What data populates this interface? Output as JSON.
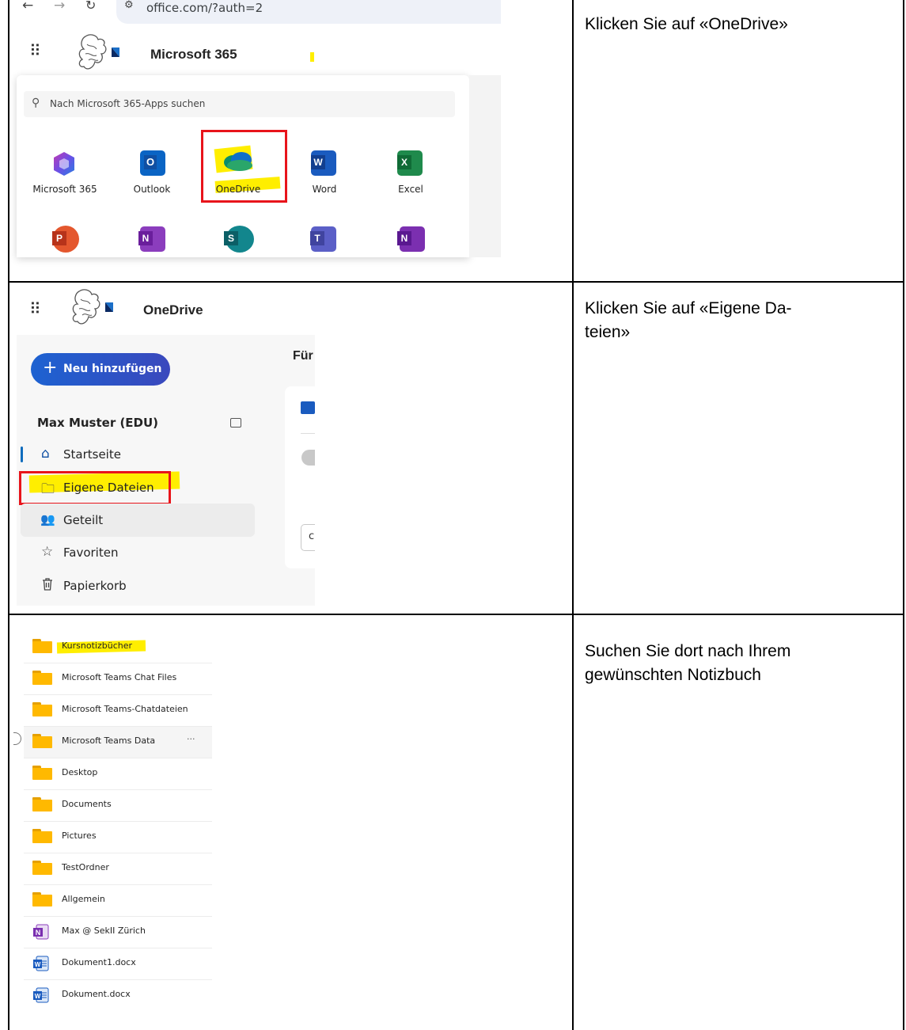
{
  "instructions": [
    "Klicken Sie auf «OneDrive»",
    "Klicken Sie auf «Eigene Da-\nteien»",
    "Suchen Sie dort nach Ihrem gewünschten Notizbuch"
  ],
  "step1": {
    "url": "office.com/?auth=2",
    "app_title": "Microsoft 365",
    "search_placeholder": "Nach Microsoft 365-Apps suchen",
    "apps_row1": [
      "Microsoft 365",
      "Outlook",
      "OneDrive",
      "Word",
      "Excel"
    ],
    "icon_letters": {
      "outlook": "O",
      "word": "W",
      "excel": "X",
      "powerpoint": "P",
      "onenote": "N",
      "sharepoint": "S",
      "teams": "T",
      "class_notebook": "N"
    },
    "colors": {
      "highlight": "#ffee00",
      "red_frame": "#e8141b"
    }
  },
  "step2": {
    "app_title": "OneDrive",
    "new_button": "Neu hinzufügen",
    "user": "Max Muster (EDU)",
    "nav": [
      "Startseite",
      "Eigene Dateien",
      "Geteilt",
      "Favoriten",
      "Papierkorb"
    ],
    "main_heading_partial": "Für",
    "main_partial_char": "c",
    "accent": "#0f6cbd"
  },
  "step3": {
    "files": [
      {
        "name": "Kursnotizbücher",
        "icon": "folder-icon"
      },
      {
        "name": "Microsoft Teams Chat Files",
        "icon": "folder-icon"
      },
      {
        "name": "Microsoft Teams-Chatdateien",
        "icon": "folder-icon"
      },
      {
        "name": "Microsoft Teams Data",
        "icon": "folder-icon"
      },
      {
        "name": "Desktop",
        "icon": "folder-icon"
      },
      {
        "name": "Documents",
        "icon": "folder-icon"
      },
      {
        "name": "Pictures",
        "icon": "folder-icon"
      },
      {
        "name": "TestOrdner",
        "icon": "folder-icon"
      },
      {
        "name": "Allgemein",
        "icon": "folder-icon"
      },
      {
        "name": "Max @ SekII Zürich",
        "icon": "onenote-icon"
      },
      {
        "name": "Dokument1.docx",
        "icon": "word-file-icon"
      },
      {
        "name": "Dokument.docx",
        "icon": "word-file-icon"
      }
    ],
    "more_glyph": "···"
  }
}
